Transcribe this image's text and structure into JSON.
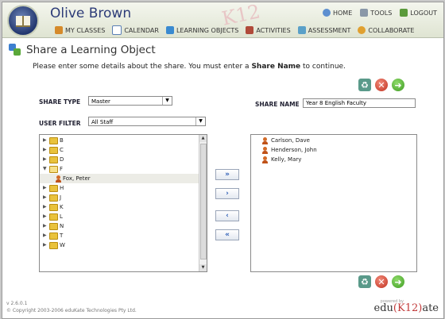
{
  "header": {
    "user_name": "Olive Brown",
    "deco_text": "K12",
    "top_nav": [
      {
        "label": "HOME",
        "icon": "home-icon"
      },
      {
        "label": "TOOLS",
        "icon": "tools-icon"
      },
      {
        "label": "LOGOUT",
        "icon": "logout-icon"
      }
    ],
    "main_nav": [
      {
        "label": "MY CLASSES",
        "icon": "classes-icon"
      },
      {
        "label": "CALENDAR",
        "icon": "calendar-icon"
      },
      {
        "label": "LEARNING OBJECTS",
        "icon": "learning-objects-icon"
      },
      {
        "label": "ACTIVITIES",
        "icon": "activities-icon"
      },
      {
        "label": "ASSESSMENT",
        "icon": "assessment-icon"
      },
      {
        "label": "COLLABORATE",
        "icon": "collaborate-icon"
      }
    ]
  },
  "page": {
    "title": "Share a Learning Object",
    "instruction_pre": "Please enter some details about the share. You must enter a ",
    "instruction_bold": "Share Name",
    "instruction_post": " to continue."
  },
  "form": {
    "share_type_label": "SHARE TYPE",
    "share_type_value": "Master",
    "share_name_label": "SHARE NAME",
    "share_name_value": "Year 8 English Faculty",
    "user_filter_label": "USER FILTER",
    "user_filter_value": "All Staff"
  },
  "left_tree": [
    {
      "label": "B",
      "type": "folder",
      "expanded": false
    },
    {
      "label": "C",
      "type": "folder",
      "expanded": false
    },
    {
      "label": "D",
      "type": "folder",
      "expanded": false
    },
    {
      "label": "F",
      "type": "folder",
      "expanded": true
    },
    {
      "label": "Fox, Peter",
      "type": "person",
      "selected": true
    },
    {
      "label": "H",
      "type": "folder",
      "expanded": false
    },
    {
      "label": "J",
      "type": "folder",
      "expanded": false
    },
    {
      "label": "K",
      "type": "folder",
      "expanded": false
    },
    {
      "label": "L",
      "type": "folder",
      "expanded": false
    },
    {
      "label": "N",
      "type": "folder",
      "expanded": false
    },
    {
      "label": "T",
      "type": "folder",
      "expanded": false
    },
    {
      "label": "W",
      "type": "folder",
      "expanded": false
    }
  ],
  "right_list": [
    "Carlson, Dave",
    "Henderson, John",
    "Kelly, Mary"
  ],
  "move_buttons": [
    {
      "glyph": "»",
      "name": "add-all-button"
    },
    {
      "glyph": "›",
      "name": "add-selected-button"
    },
    {
      "glyph": "‹",
      "name": "remove-selected-button"
    },
    {
      "glyph": "«",
      "name": "remove-all-button"
    }
  ],
  "footer": {
    "version": "v 2.6.0.1",
    "copyright": "© Copyright 2003-2006 eduKate Technologies Pty Ltd.",
    "powered": "powered by",
    "brand_pre": "edu",
    "brand_k12": "(K12)",
    "brand_post": "ate"
  },
  "colors": {
    "accent": "#2d3c78",
    "cancel": "#c0311f",
    "go": "#3e9a22"
  }
}
